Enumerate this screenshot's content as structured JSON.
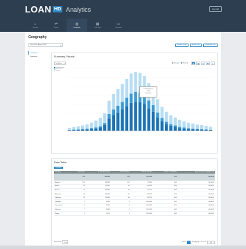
{
  "brand": {
    "name": "LOAN",
    "badge": "HD",
    "sub": "Analytics",
    "logout": "Log out"
  },
  "nav": [
    {
      "label": "Overview",
      "icon": "⌂"
    },
    {
      "label": "Pipeline",
      "icon": "⇄"
    },
    {
      "label": "Geography",
      "icon": "◎"
    },
    {
      "label": "Loan Type",
      "icon": "▦"
    },
    {
      "label": "Production",
      "icon": "▭"
    }
  ],
  "page": {
    "title": "Geography",
    "period": "July 2014 - August 2015",
    "buttons": [
      "Refresh Data",
      "Export Data",
      "Download PDF"
    ]
  },
  "side": [
    "Locations",
    "Companies"
  ],
  "chart": {
    "title": "Summary Visuals",
    "select": "Top States",
    "toggle_a": "Grouped",
    "toggle_b": "Stacked",
    "tooltip": [
      "Loan Scenario",
      "Total",
      "Scenarios"
    ]
  },
  "chart_data": {
    "type": "bar",
    "ylim": [
      0,
      280
    ],
    "series": [
      {
        "name": "",
        "color": "#1a73b4",
        "values": [
          2,
          3,
          4,
          5,
          6,
          8,
          10,
          14,
          25,
          55,
          70,
          82,
          96,
          110,
          125,
          130,
          128,
          120,
          100,
          85,
          60,
          42,
          30,
          22,
          18,
          12,
          10,
          8,
          7,
          6,
          5,
          4,
          3
        ]
      },
      {
        "name": "",
        "color": "#3a9bd5",
        "values": [
          1,
          2,
          2,
          3,
          3,
          4,
          5,
          6,
          9,
          20,
          25,
          30,
          34,
          38,
          42,
          45,
          44,
          42,
          36,
          30,
          22,
          15,
          11,
          8,
          6,
          5,
          4,
          3,
          3,
          2,
          2,
          2,
          1
        ]
      },
      {
        "name": "",
        "color": "#b7ddf3",
        "values": [
          10,
          12,
          14,
          16,
          20,
          24,
          30,
          38,
          45,
          60,
          70,
          75,
          80,
          85,
          90,
          90,
          88,
          84,
          78,
          70,
          60,
          50,
          44,
          40,
          36,
          32,
          28,
          24,
          22,
          20,
          18,
          16,
          14
        ]
      }
    ]
  },
  "table": {
    "title": "Data Table",
    "tag": "Locations",
    "headers": [
      "Location",
      "Scenarios",
      "% Total Scenarios",
      "Units Funded",
      "% Units Funded",
      "Mean - Fund Rate",
      "Avg. Turnaround (Approval)"
    ],
    "total": [
      "",
      "152",
      "100.00%",
      "152",
      "100.00%",
      "1.00",
      "00:00:00"
    ],
    "rows": [
      [
        "Alabama",
        "151",
        "99.34%",
        "152",
        "77.64%",
        "1.00",
        "00:00:01"
      ],
      [
        "Alaska",
        "50",
        "32.89%",
        "50",
        "40.38%",
        "2.83",
        "00:00:01"
      ],
      [
        "Arizona",
        "74",
        "48.68%",
        "74",
        "72.51%",
        "1.00",
        "00:00:03"
      ],
      [
        "Arkansas",
        "66",
        "43.42%",
        "66",
        "33.29%",
        "1.01",
        "00:00:02"
      ],
      [
        "California",
        "16",
        "10.53%",
        "16",
        "54.57%",
        "1.00",
        "00:00:01"
      ],
      [
        "Colorado",
        "9",
        "5.92%",
        "9",
        "100.00%",
        "1.00",
        "00:00:01"
      ],
      [
        "Connecticut",
        "6",
        "3.95%",
        "6",
        "100.00%",
        "1.00",
        "00:00:01"
      ],
      [
        "Delaware",
        "1",
        "0.66%",
        "1",
        "100.00%",
        "1.00",
        "00:00:01"
      ],
      [
        "Florida",
        "3",
        "1.97%",
        "3",
        "100.00%",
        "1.00",
        "00:00:01"
      ]
    ],
    "show": "Show rows",
    "rows_count": "10",
    "goto": "Go to",
    "page": "1",
    "range": "Displaying 1-10 of 50"
  }
}
